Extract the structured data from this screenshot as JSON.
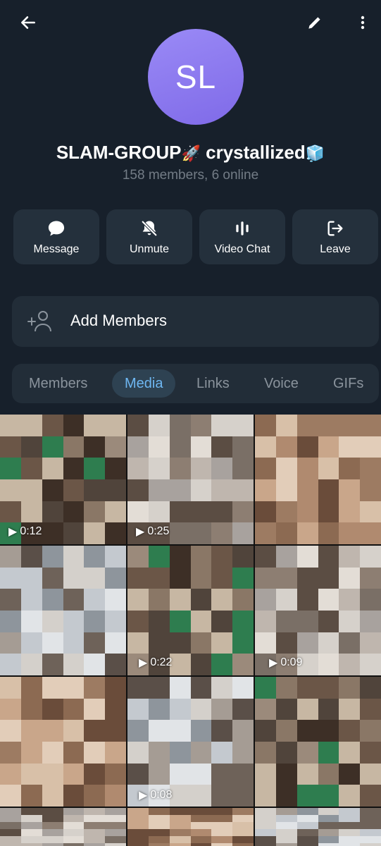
{
  "header": {
    "back_icon": "arrow-left-icon",
    "edit_icon": "pencil-icon",
    "more_icon": "more-vertical-icon"
  },
  "profile": {
    "avatar_initials": "SL",
    "avatar_color": "#8f7ef1",
    "title_main": "SLAM-GROUP",
    "title_emoji_1": "🚀",
    "title_suffix": " crystallized",
    "title_emoji_2": "🧊",
    "subtitle": "158 members, 6 online"
  },
  "actions": [
    {
      "label": "Message",
      "icon": "chat-bubble-icon"
    },
    {
      "label": "Unmute",
      "icon": "bell-off-icon"
    },
    {
      "label": "Video Chat",
      "icon": "voice-bars-icon"
    },
    {
      "label": "Leave",
      "icon": "logout-icon"
    }
  ],
  "add_members": {
    "label": "Add Members",
    "icon": "add-user-icon"
  },
  "tabs": [
    "Members",
    "Media",
    "Links",
    "Voice",
    "GIFs"
  ],
  "active_tab": "Media",
  "media": [
    {
      "duration": "0:12"
    },
    {
      "duration": "0:25"
    },
    {
      "duration": ""
    },
    {
      "duration": ""
    },
    {
      "duration": "0:22"
    },
    {
      "duration": "0:09"
    },
    {
      "duration": ""
    },
    {
      "duration": "0:08"
    },
    {
      "duration": ""
    }
  ],
  "colors": {
    "background": "#17202b",
    "card": "#24303c",
    "accent": "#6eb7f2",
    "muted_text": "#737c86"
  }
}
